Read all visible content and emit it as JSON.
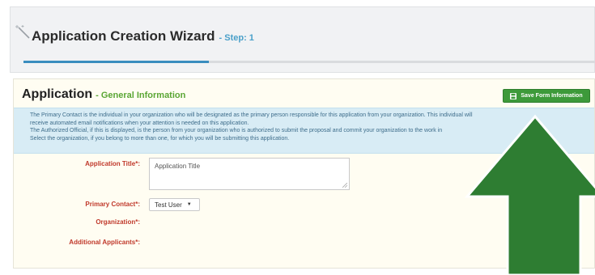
{
  "wizard": {
    "title": "Application Creation Wizard",
    "step": "- Step: 1",
    "progress_fraction": 0.32
  },
  "form": {
    "heading": "Application",
    "subheading": "- General Information",
    "save_button": "Save Form Information",
    "info_lines": [
      "The Primary Contact is the individual in your organization who will be designated as the primary person responsible for this application from your organization. This individual will",
      "receive automated email notifications when your attention is needed on this application.",
      "The Authorized Official, if this is displayed, is the person from your organization who is authorized to submit the proposal and commit your organization to the work in",
      "Select the organization, if you belong to more than one, for which you will be submitting this application."
    ],
    "fields": {
      "application_title_label": "Application Title*:",
      "application_title_value": "Application Title",
      "primary_contact_label": "Primary Contact*:",
      "primary_contact_value": "Test User",
      "organization_label": "Organization*:",
      "additional_applicants_label": "Additional Applicants*:"
    }
  },
  "colors": {
    "arrow": "#2e7d32",
    "save_button": "#3d9a3a",
    "label": "#c0392b",
    "accent": "#3a8dbf"
  }
}
